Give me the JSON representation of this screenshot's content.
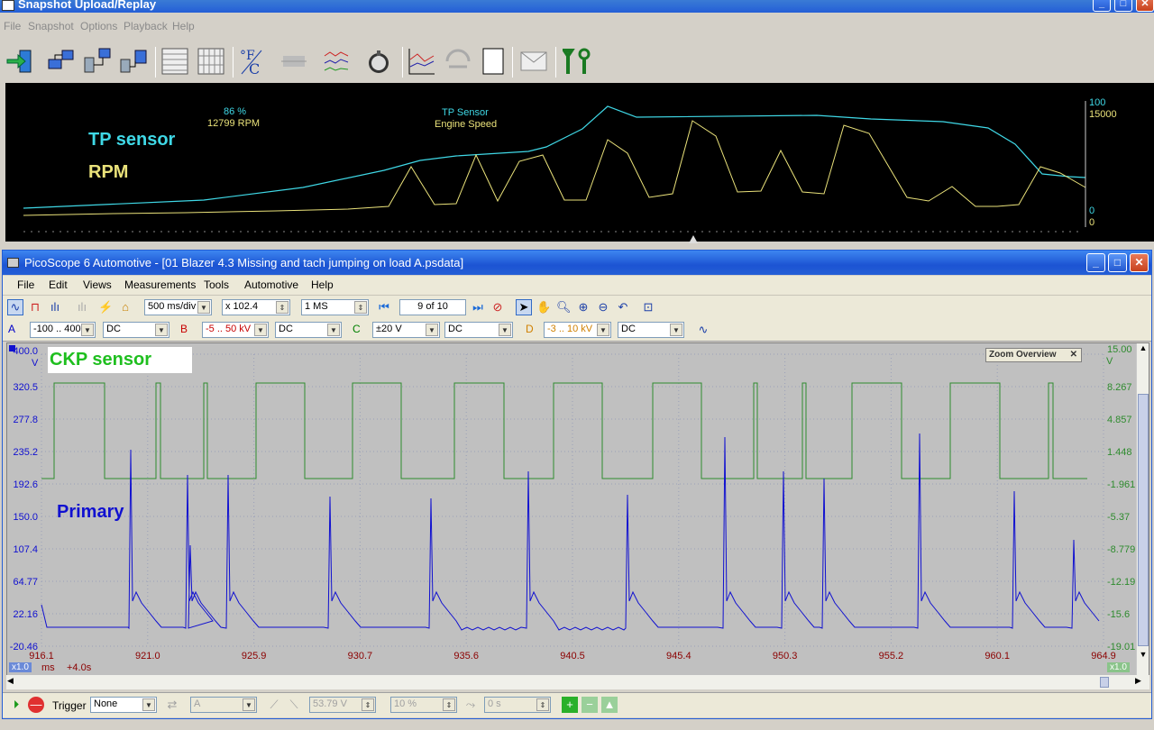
{
  "outer": {
    "title": "Snapshot Upload/Replay",
    "menu": [
      "File",
      "Snapshot",
      "Options",
      "Playback",
      "Help"
    ],
    "toolbar_icons": [
      "exit-icon",
      "upload-icon",
      "download-icon",
      "transfer-icon",
      "grid-icon",
      "grid2-icon",
      "temperature-unit-icon",
      "flat-icon",
      "multi-line-chart-icon",
      "lock-icon",
      "line-chart-icon",
      "record-icon",
      "blank-icon",
      "mail-icon",
      "tools-icon"
    ]
  },
  "overview": {
    "label_tp": "TP sensor",
    "label_rpm": "RPM",
    "readout_value1": "86 %",
    "readout_value2": "12799 RPM",
    "legend_line1": "TP Sensor",
    "legend_line2": "Engine Speed",
    "axis_top1": "100",
    "axis_top2": "15000",
    "axis_bottom1": "0",
    "axis_bottom2": "0",
    "colors": {
      "tp": "#3fd8e6",
      "rpm": "#eae27a"
    }
  },
  "inner": {
    "title": "PicoScope 6 Automotive - [01 Blazer 4.3 Missing and tach jumping on load A.psdata]",
    "menu": [
      "File",
      "Edit",
      "Views",
      "Measurements",
      "Tools",
      "Automotive",
      "Help"
    ],
    "timebase": "500 ms/div",
    "zoom": "x 102.4",
    "samples": "1 MS",
    "buffer": "9 of 10",
    "channels": [
      {
        "name": "A",
        "range": "-100 .. 400",
        "coupling": "DC",
        "color": "#0000c8"
      },
      {
        "name": "B",
        "range": "-5 .. 50 kV",
        "coupling": "DC",
        "color": "#c80000"
      },
      {
        "name": "C",
        "range": "±20 V",
        "coupling": "DC",
        "color": "#008000"
      },
      {
        "name": "D",
        "range": "-3 .. 10 kV",
        "coupling": "DC",
        "color": "#d08000"
      }
    ],
    "scope": {
      "ckp_label": "CKP sensor",
      "primary_label": "Primary",
      "zoom_overview": "Zoom Overview",
      "left_unit": "V",
      "right_unit": "V",
      "left_ticks": [
        "400.0",
        "320.5",
        "277.8",
        "235.2",
        "192.6",
        "150.0",
        "107.4",
        "64.77",
        "22.16",
        "-20.46"
      ],
      "right_ticks": [
        "15.00",
        "8.267",
        "4.857",
        "1.448",
        "-1.961",
        "-5.37",
        "-8.779",
        "-12.19",
        "-15.6",
        "-19.01"
      ],
      "x_ticks": [
        "916.1",
        "921.0",
        "925.9",
        "930.7",
        "935.6",
        "940.5",
        "945.4",
        "950.3",
        "955.2",
        "960.1",
        "964.9"
      ],
      "x_unit": "ms",
      "x_scale_left": "x1.0",
      "x_scale_right": "x1.0",
      "x_offset": "+4.0s",
      "colors": {
        "ckp": "#2e8b2e",
        "primary": "#1010d0",
        "grid": "#9aa0b8"
      }
    },
    "status": {
      "trigger_label": "Trigger",
      "trigger_mode": "None",
      "source": "A",
      "threshold": "53.79 V",
      "pretrigger": "10 %",
      "delay": "0 s"
    }
  }
}
